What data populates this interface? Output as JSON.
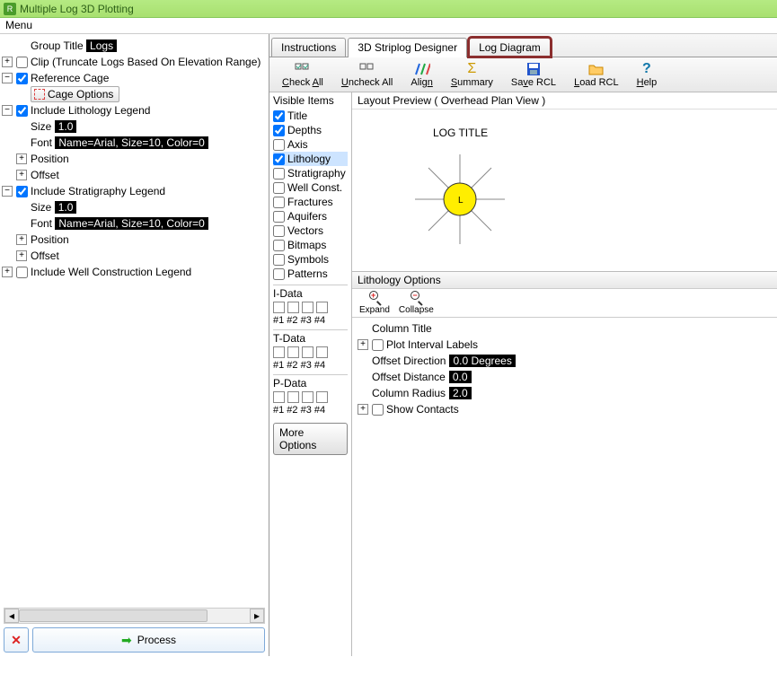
{
  "window": {
    "title": "Multiple Log 3D Plotting"
  },
  "menu": {
    "label": "Menu"
  },
  "tree": {
    "group_title_label": "Group Title",
    "group_title_value": "Logs",
    "clip_label": "Clip (Truncate Logs Based On Elevation Range)",
    "reference_cage": "Reference Cage",
    "cage_options": "Cage Options",
    "inc_litho": "Include Lithology Legend",
    "size_label": "Size",
    "size_value": "1.0",
    "font_label": "Font",
    "font_value": "Name=Arial, Size=10, Color=0",
    "position": "Position",
    "offset": "Offset",
    "inc_strat": "Include Stratigraphy Legend",
    "inc_well": "Include Well Construction Legend"
  },
  "process_btn": "Process",
  "tabs": {
    "instructions": "Instructions",
    "designer": "3D Striplog Designer",
    "diagram": "Log Diagram"
  },
  "toolbar": {
    "check_all": "Check All",
    "uncheck_all": "Uncheck All",
    "align": "Align",
    "summary": "Summary",
    "save_rcl": "Save RCL",
    "load_rcl": "Load RCL",
    "help": "Help"
  },
  "visible": {
    "header": "Visible Items",
    "title": "Title",
    "depths": "Depths",
    "axis": "Axis",
    "lithology": "Lithology",
    "stratigraphy": "Stratigraphy",
    "wellconst": "Well Const.",
    "fractures": "Fractures",
    "aquifers": "Aquifers",
    "vectors": "Vectors",
    "bitmaps": "Bitmaps",
    "symbols": "Symbols",
    "patterns": "Patterns",
    "idata": "I-Data",
    "tdata": "T-Data",
    "pdata": "P-Data",
    "hash": "#1 #2 #3 #4",
    "more": "More Options"
  },
  "preview": {
    "header": "Layout Preview  ( Overhead Plan View )",
    "log_title": "LOG TITLE",
    "L": "L"
  },
  "options": {
    "header": "Lithology Options",
    "expand": "Expand",
    "collapse": "Collapse",
    "column_title": "Column Title",
    "column_title_val": "    ",
    "plot_interval": "Plot Interval Labels",
    "offset_direction": "Offset Direction",
    "offset_direction_val": "0.0 Degrees",
    "offset_distance": "Offset Distance",
    "offset_distance_val": "0.0",
    "column_radius": "Column Radius",
    "column_radius_val": "2.0",
    "show_contacts": "Show Contacts"
  }
}
